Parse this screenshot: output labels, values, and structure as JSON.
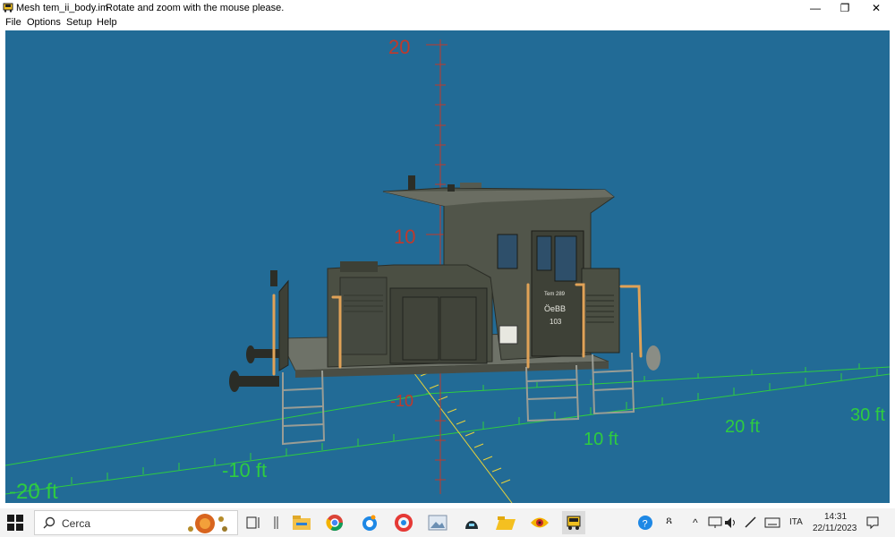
{
  "window": {
    "title": "Mesh tem_ii_body.im",
    "hint": "Rotate and zoom with the mouse please.",
    "minimize_icon": "—",
    "restore_icon": "❐",
    "close_icon": "✕"
  },
  "menu": [
    "File",
    "Options",
    "Setup",
    "Help"
  ],
  "viewport": {
    "background": "#226b96",
    "vertical_axis_labels": [
      "20",
      "10",
      "-10"
    ],
    "ground_axis_labels": [
      "10 ft",
      "20 ft",
      "30 ft",
      "-10 ft",
      "-20 ft"
    ],
    "model": {
      "body_color": "#4b4f43",
      "rail_color": "#e0a257",
      "cab_number": "Tem 289",
      "road_name": "ÖeBB",
      "unit_number": "103"
    }
  },
  "taskbar": {
    "search_placeholder": "Cerca",
    "apps": [
      "task-view",
      "file-explorer",
      "chrome",
      "app-blue-circle",
      "app-red-swirl",
      "image-viewer",
      "app-dark-helmet",
      "folder-yellow",
      "app-eye",
      "app-train-active"
    ],
    "tray": {
      "help_icon": "?",
      "people_icon": "ጸ",
      "chevron": "^",
      "language": "ITA",
      "time": "14:31",
      "date": "22/11/2023"
    }
  }
}
